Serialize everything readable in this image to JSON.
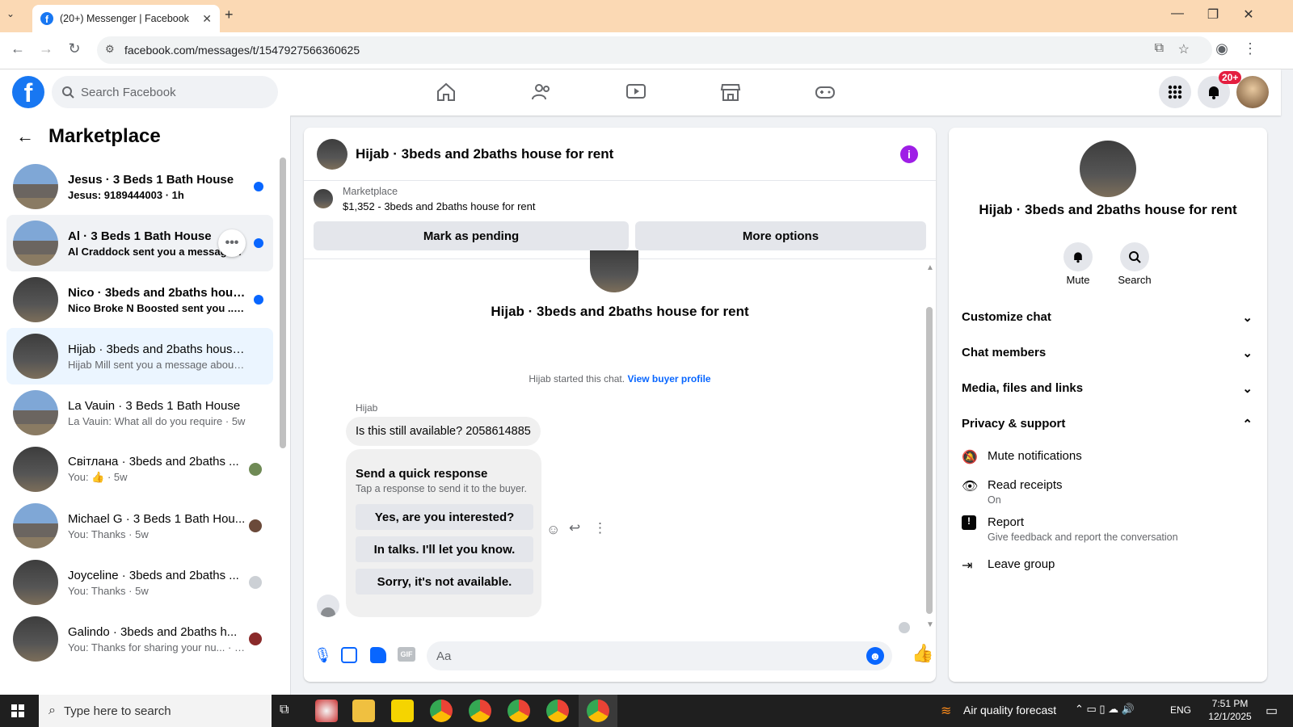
{
  "browser": {
    "tab_title": "(20+) Messenger | Facebook",
    "url": "facebook.com/messages/t/1547927566360625"
  },
  "fb": {
    "search_placeholder": "Search Facebook",
    "notif_badge": "20+"
  },
  "left": {
    "title": "Marketplace",
    "conversations": [
      {
        "title": "Jesus · 3 Beds 1 Bath House",
        "preview": "Jesus: 9189444003 · 1h",
        "unread": true
      },
      {
        "title": "Al · 3 Beds 1 Bath House",
        "preview": "Al Craddock sent you a message...",
        "unread": true
      },
      {
        "title": "Nico · 3beds and 2baths house...",
        "preview": "Nico Broke N Boosted sent you ... · 4h",
        "unread": true
      },
      {
        "title": "Hijab · 3beds and 2baths house ...",
        "preview": "Hijab Mill sent you a message abou... · 5h",
        "unread": false
      },
      {
        "title": "La Vauin · 3 Beds 1 Bath House",
        "preview": "La Vauin: What all do you require · 5w",
        "unread": false
      },
      {
        "title": "Світлана · 3beds and 2baths ...",
        "preview": "You: 👍 · 5w",
        "unread": false
      },
      {
        "title": "Michael G · 3 Beds 1 Bath Hou...",
        "preview": "You: Thanks · 5w",
        "unread": false
      },
      {
        "title": "Joyceline · 3beds and 2baths ...",
        "preview": "You: Thanks · 5w",
        "unread": false
      },
      {
        "title": "Galindo · 3beds and 2baths h...",
        "preview": "You: Thanks for sharing your nu... · 5w",
        "unread": false
      }
    ]
  },
  "chat": {
    "header_title": "Hijab · 3beds and 2baths house for rent",
    "listing_label": "Marketplace",
    "listing_price": "$1,352 - 3beds and 2baths house for rent",
    "mark_pending": "Mark as pending",
    "more_options": "More options",
    "profile_name": "Hijab · 3beds and 2baths house for rent",
    "started_text": "Hijab started this chat.",
    "view_buyer": "View buyer profile",
    "sender": "Hijab",
    "message": "Is this still available? 2058614885",
    "quick_title": "Send a quick response",
    "quick_sub": "Tap a response to send it to the buyer.",
    "quick_responses": [
      "Yes, are you interested?",
      "In talks. I'll let you know.",
      "Sorry, it's not available."
    ],
    "composer_placeholder": "Aa"
  },
  "details": {
    "name": "Hijab · 3beds and 2baths house for rent",
    "mute": "Mute",
    "search": "Search",
    "sections": [
      "Customize chat",
      "Chat members",
      "Media, files and links",
      "Privacy & support"
    ],
    "mute_notifications": "Mute notifications",
    "read_receipts": "Read receipts",
    "read_receipts_state": "On",
    "report": "Report",
    "report_sub": "Give feedback and report the conversation",
    "leave_group": "Leave group"
  },
  "taskbar": {
    "search_placeholder": "Type here to search",
    "weather": "Air quality forecast",
    "lang": "ENG",
    "time": "7:51 PM",
    "date": "12/1/2025"
  },
  "colors": {
    "accent": "#0866ff",
    "brand": "#1877f2",
    "info": "#9e1ee6"
  }
}
